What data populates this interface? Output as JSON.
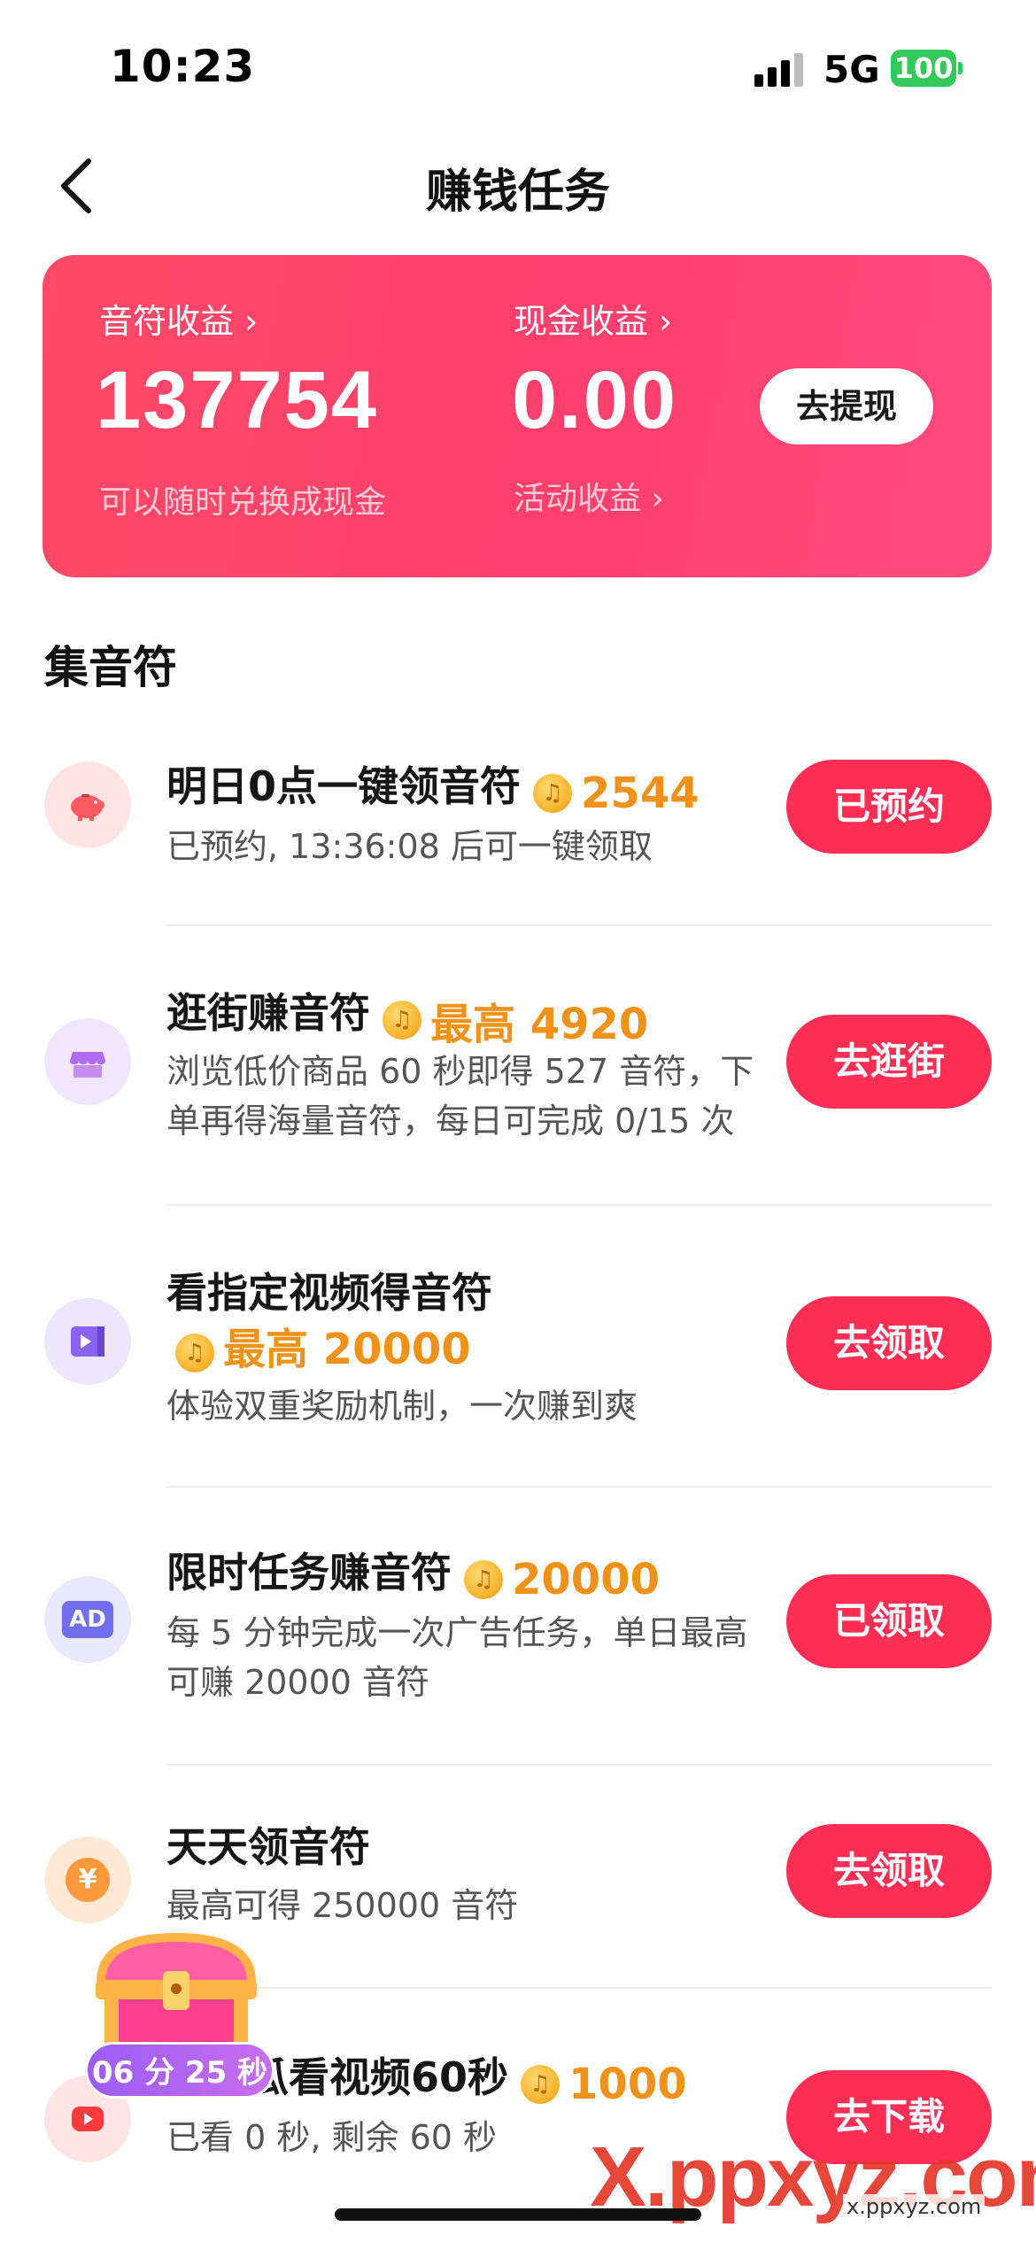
{
  "status_bar": {
    "time": "10:23",
    "network": "5G",
    "battery": "100"
  },
  "nav": {
    "title": "赚钱任务"
  },
  "earnings": {
    "note_label": "音符收益 ›",
    "note_value": "137754",
    "note_sub": "可以随时兑换成现金",
    "cash_label": "现金收益 ›",
    "cash_value": "0.00",
    "cash_sub": "活动收益 ›",
    "withdraw_button": "去提现"
  },
  "section": {
    "title": "集音符"
  },
  "tasks": [
    {
      "title": "明日0点一键领音符",
      "reward": "2544",
      "desc": "已预约, 13:36:08  后可一键领取",
      "button": "已预约",
      "icon": "piggy-bank-icon"
    },
    {
      "title": "逛街赚音符",
      "reward": "最高 4920",
      "desc": "浏览低价商品 60 秒即得 527 音符，下单再得海量音符，每日可完成 0/15 次",
      "button": "去逛街",
      "icon": "shop-icon"
    },
    {
      "title": "看指定视频得音符",
      "reward": "最高 20000",
      "desc": "体验双重奖励机制，一次赚到爽",
      "button": "去领取",
      "icon": "video-icon"
    },
    {
      "title": "限时任务赚音符",
      "reward": "20000",
      "desc": "每 5 分钟完成一次广告任务，单日最高可赚 20000 音符",
      "button": "已领取",
      "icon": "ad-icon",
      "icon_text": "AD"
    },
    {
      "title": "天天领音符",
      "reward": "",
      "desc": "最高可得 250000 音符",
      "button": "去领取",
      "icon": "yen-coin-icon",
      "icon_text": "¥"
    },
    {
      "title": "去西瓜看视频60秒",
      "reward": "1000",
      "desc": "已看 0 秒, 剩余 60 秒",
      "button": "去下载",
      "icon": "play-icon"
    }
  ],
  "floating": {
    "timer": "06 分 25 秒"
  },
  "watermark": {
    "main": "X.ppxyz.com",
    "small": "x.ppxyz.com"
  },
  "colors": {
    "accent": "#ff2e55",
    "card": "#ff4966",
    "reward": "#f0921a"
  }
}
